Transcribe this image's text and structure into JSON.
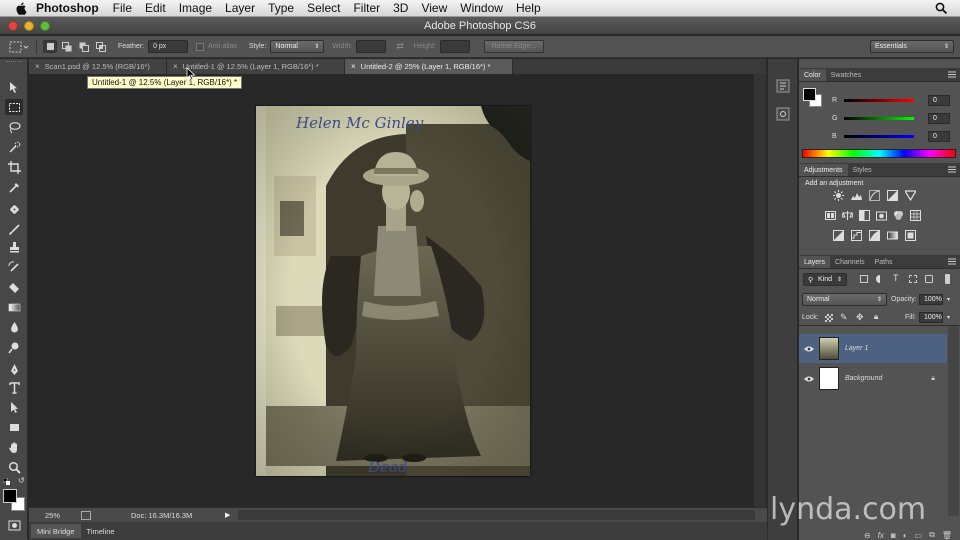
{
  "menubar": {
    "app_name": "Photoshop",
    "items": [
      "File",
      "Edit",
      "Image",
      "Layer",
      "Type",
      "Select",
      "Filter",
      "3D",
      "View",
      "Window",
      "Help"
    ]
  },
  "window": {
    "title": "Adobe Photoshop CS6"
  },
  "options_bar": {
    "feather_label": "Feather:",
    "feather_value": "0 px",
    "antialias_label": "Anti-alias",
    "style_label": "Style:",
    "style_value": "Normal",
    "width_label": "Width:",
    "height_label": "Height:",
    "refine_edge_label": "Refine Edge...",
    "workspace_value": "Essentials"
  },
  "document_tabs": [
    {
      "label": "Scan1.psd @ 12.5% (RGB/16*)",
      "active": false
    },
    {
      "label": "Untitled-1 @ 12.5% (Layer 1, RGB/16*) *",
      "active": false
    },
    {
      "label": "Untitled-2 @ 25% (Layer 1, RGB/16*) *",
      "active": true
    }
  ],
  "tooltip": "Untitled-1 @ 12.5% (Layer 1, RGB/16*) *",
  "status_bar": {
    "zoom": "25%",
    "doc_info": "Doc: 16.3M/16.3M"
  },
  "bottom_tabs": [
    "Mini Bridge",
    "Timeline"
  ],
  "color_panel": {
    "tabs": [
      "Color",
      "Swatches"
    ],
    "channels": [
      {
        "label": "R",
        "value": "0"
      },
      {
        "label": "G",
        "value": "0"
      },
      {
        "label": "B",
        "value": "0"
      }
    ]
  },
  "adjustments_panel": {
    "tabs": [
      "Adjustments",
      "Styles"
    ],
    "heading": "Add an adjustment"
  },
  "layers_panel": {
    "tabs": [
      "Layers",
      "Channels",
      "Paths"
    ],
    "filter_kind": "Kind",
    "blend_mode": "Normal",
    "opacity_label": "Opacity:",
    "opacity_value": "100%",
    "lock_label": "Lock:",
    "fill_label": "Fill:",
    "fill_value": "100%",
    "layers": [
      {
        "name": "Layer 1",
        "selected": true
      },
      {
        "name": "Background",
        "selected": false,
        "locked": true
      }
    ]
  },
  "photo": {
    "top_inscription": "Helen Mc Ginley",
    "bottom_inscription": "Dead"
  },
  "watermark": "lynda.com",
  "colors": {
    "foreground": "#000000",
    "background": "#ffffff",
    "layer_selected": "#4d6281",
    "panel_bg": "#535353"
  }
}
